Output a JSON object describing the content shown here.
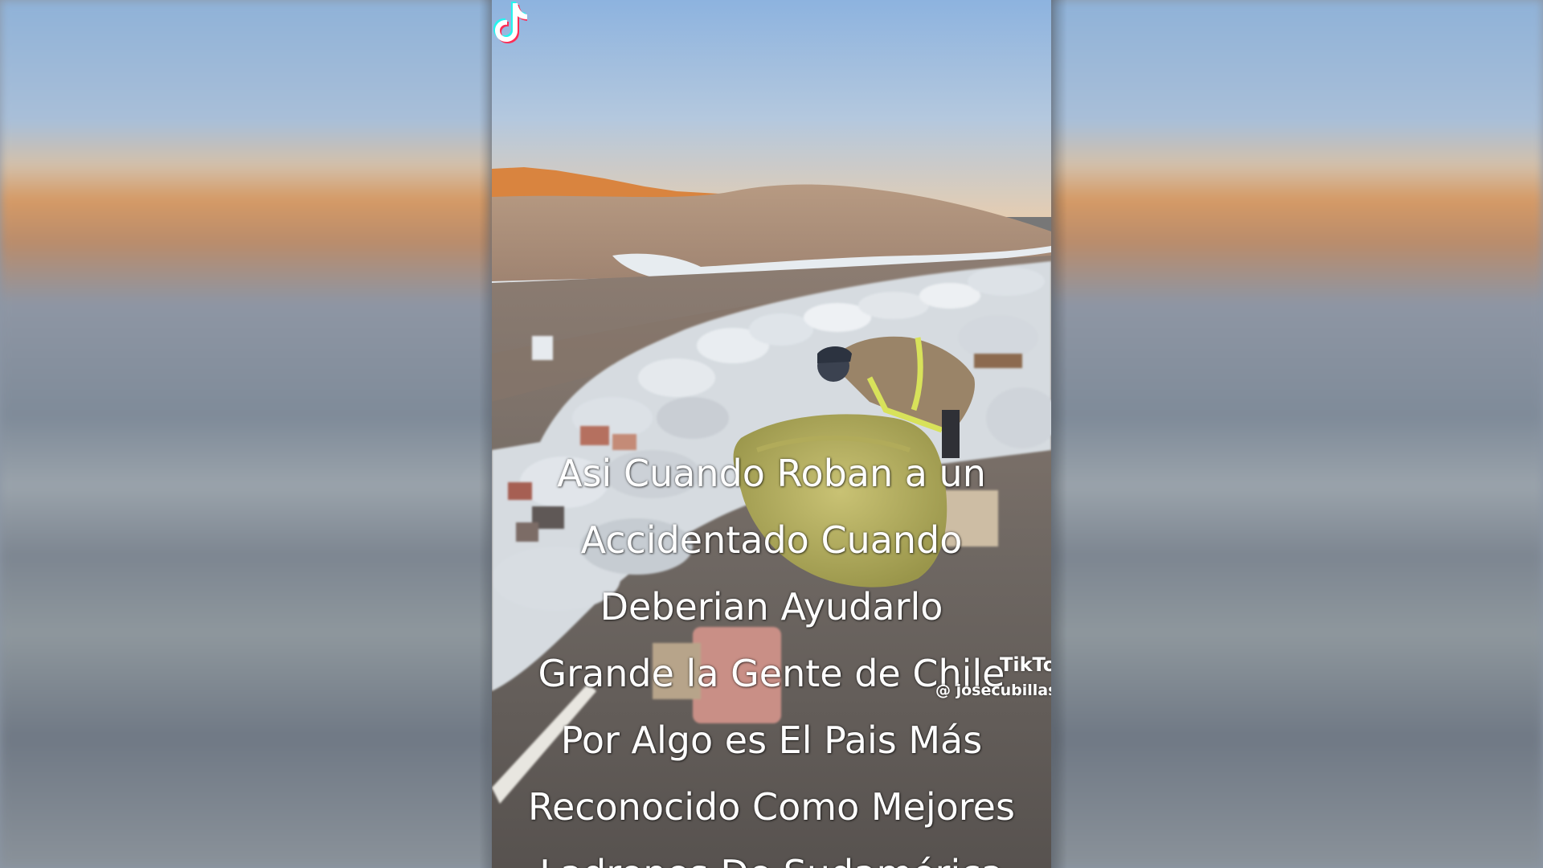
{
  "caption": {
    "lines": [
      "Asi Cuando Roban a un",
      "Accidentado Cuando",
      "Deberian Ayudarlo",
      "Grande la Gente de Chile",
      "Por Algo es El Pais Más",
      "Reconocido Como Mejores",
      "Ladrones De Sudamérica"
    ]
  },
  "watermark": {
    "brand": "TikTok",
    "handle": "@ josecubillas",
    "icon": "tiktok-logo-icon"
  },
  "colors": {
    "sky_top": "#8fb4dc",
    "sunlit_ridge": "#d9823e",
    "hill": "#a88a72",
    "caption_text": "#ffffff"
  }
}
